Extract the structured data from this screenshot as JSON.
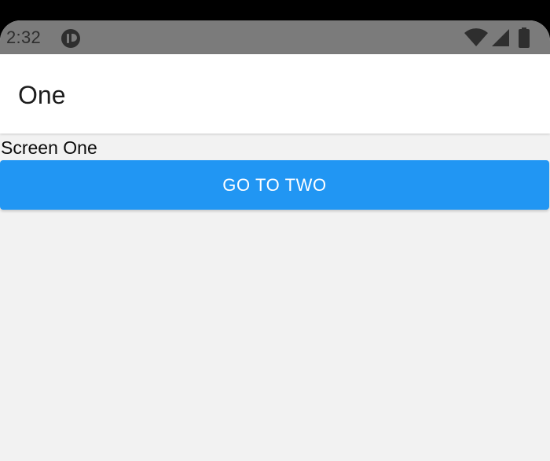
{
  "status_bar": {
    "time": "2:32",
    "icons": [
      "app-notification-icon",
      "wifi-icon",
      "signal-icon",
      "battery-icon"
    ]
  },
  "app_bar": {
    "title": "One"
  },
  "content": {
    "screen_label": "Screen One",
    "go_button_label": "GO TO TWO"
  },
  "colors": {
    "status_bar": "#7b7b7b",
    "app_bar": "#ffffff",
    "background": "#f2f2f2",
    "button": "#2196f3",
    "button_text": "#ffffff"
  }
}
